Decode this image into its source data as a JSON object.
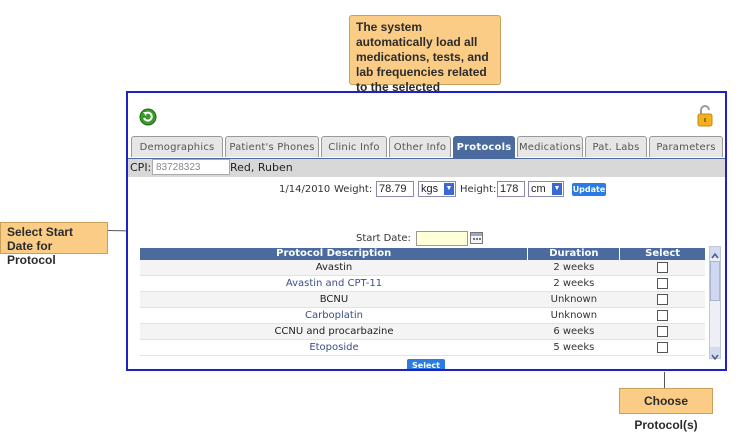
{
  "callouts": {
    "top": "The system automatically load all medications, tests, and lab frequencies related to the selected protocol(s)",
    "left": "Select Start Date for Protocol",
    "right": "Choose Protocol(s)"
  },
  "tabs": [
    {
      "label": "Demographics"
    },
    {
      "label": "Patient's Phones"
    },
    {
      "label": "Clinic Info"
    },
    {
      "label": "Other Info"
    },
    {
      "label": "Protocols",
      "active": true
    },
    {
      "label": "Medications"
    },
    {
      "label": "Pat. Labs"
    },
    {
      "label": "Parameters"
    }
  ],
  "patient": {
    "cpi_label": "CPI:",
    "cpi_value": "83728323",
    "name": "Red, Ruben"
  },
  "measurements": {
    "date": "1/14/2010",
    "weight_label": "Weight:",
    "weight_value": "78.79",
    "weight_unit": "kgs",
    "height_label": "Height:",
    "height_value": "178",
    "height_unit": "cm",
    "update_label": "Update"
  },
  "start_date": {
    "label": "Start Date:",
    "value": ""
  },
  "table": {
    "headers": [
      "Protocol Description",
      "Duration",
      "Select"
    ],
    "rows": [
      {
        "description": "Avastin",
        "duration": "2 weeks"
      },
      {
        "description": "Avastin and CPT-11",
        "duration": "2 weeks"
      },
      {
        "description": "BCNU",
        "duration": "Unknown"
      },
      {
        "description": "Carboplatin",
        "duration": "Unknown"
      },
      {
        "description": "CCNU and procarbazine",
        "duration": "6 weeks"
      },
      {
        "description": "Etoposide",
        "duration": "5 weeks"
      }
    ]
  },
  "select_button": "Select",
  "colors": {
    "accent": "#4b6b9e",
    "button": "#2a7be4",
    "callout": "#fbcc86",
    "frame": "#2020c8"
  }
}
